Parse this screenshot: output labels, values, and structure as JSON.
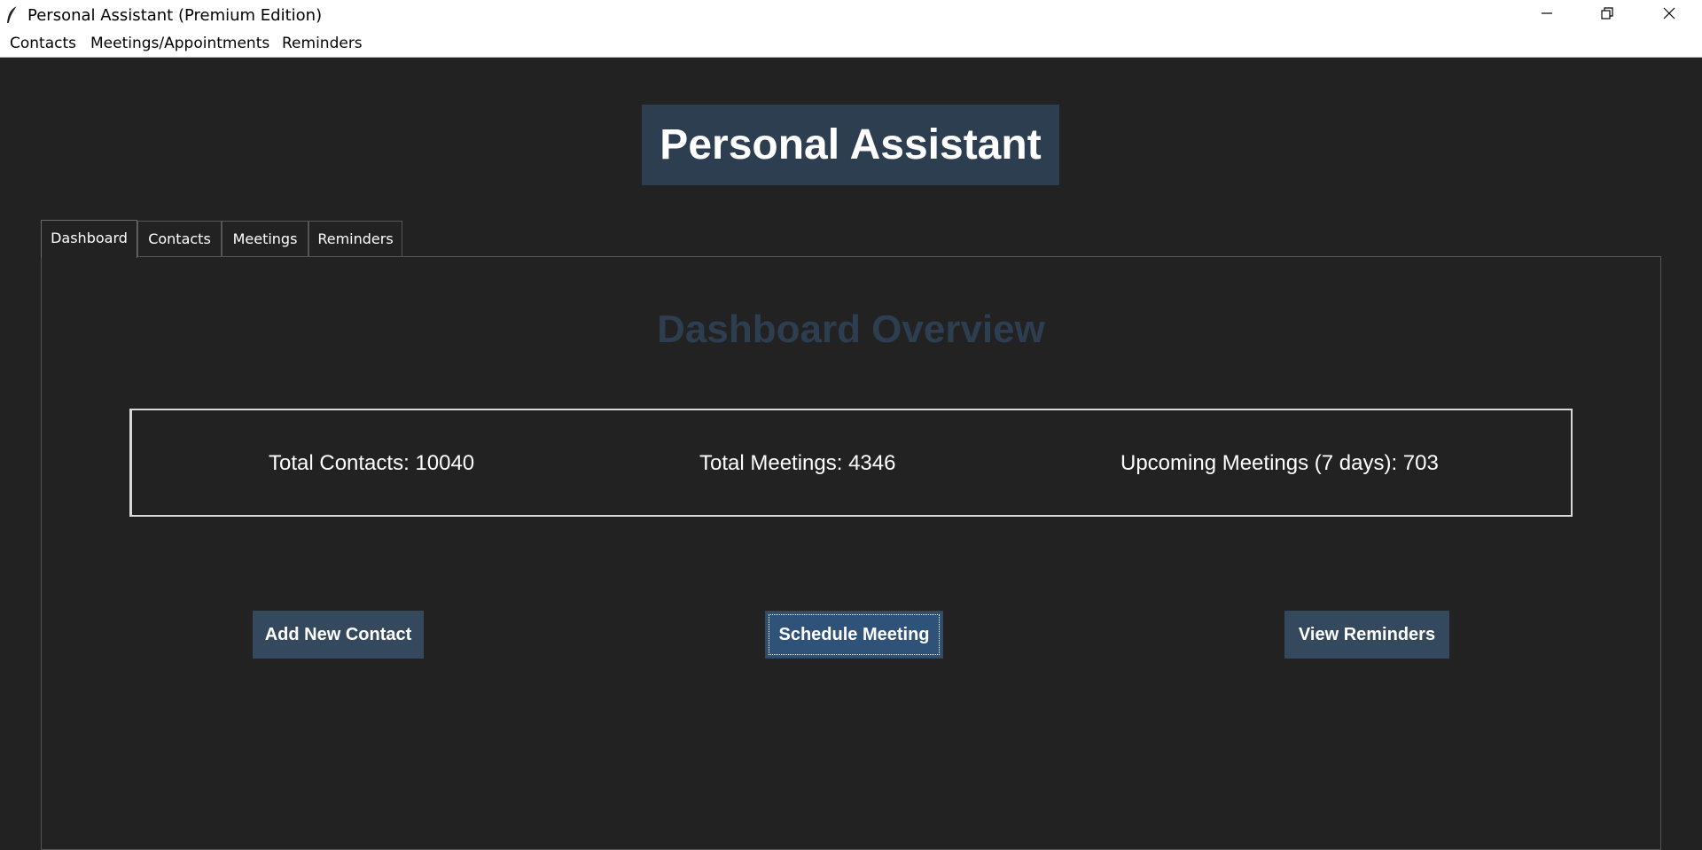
{
  "window": {
    "title": "Personal Assistant (Premium Edition)",
    "icon": "feather-icon",
    "controls": [
      "minimize-icon",
      "restore-icon",
      "close-icon"
    ]
  },
  "menubar": {
    "items": [
      {
        "label": "Contacts"
      },
      {
        "label": "Meetings/Appointments"
      },
      {
        "label": "Reminders"
      }
    ]
  },
  "header": {
    "title": "Personal Assistant"
  },
  "tabs": [
    {
      "label": "Dashboard",
      "active": true
    },
    {
      "label": "Contacts",
      "active": false
    },
    {
      "label": "Meetings",
      "active": false
    },
    {
      "label": "Reminders",
      "active": false
    }
  ],
  "dashboard": {
    "heading": "Dashboard Overview",
    "stats": {
      "total_contacts": "Total Contacts: 10040",
      "total_meetings": "Total Meetings: 4346",
      "upcoming_meetings": "Upcoming Meetings (7 days): 703"
    },
    "actions": {
      "add_contact": "Add New Contact",
      "schedule_meeting": "Schedule Meeting",
      "view_reminders": "View Reminders"
    }
  },
  "colors": {
    "background": "#222222",
    "accent": "#2c3e50",
    "button": "#34495e",
    "text": "#ffffff"
  }
}
